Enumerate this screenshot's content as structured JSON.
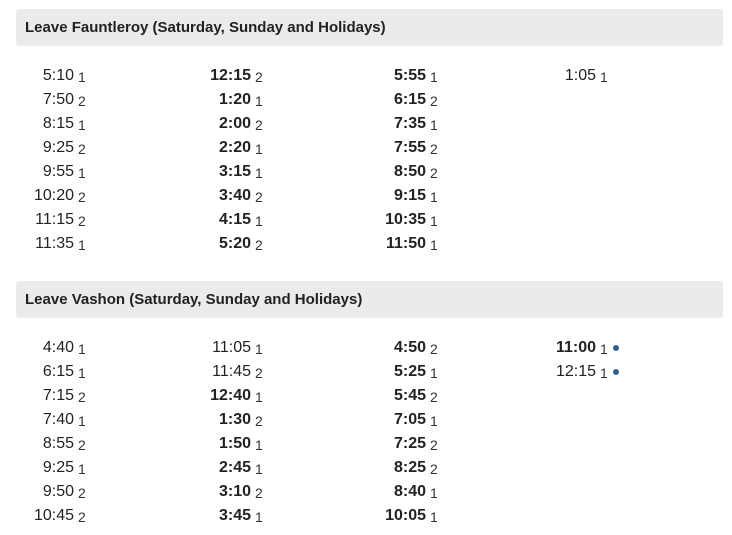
{
  "sections": [
    {
      "title": "Leave Fauntleroy (Saturday, Sunday and Holidays)",
      "columns": [
        [
          {
            "time": "5:10",
            "vessel": "1",
            "bold": false
          },
          {
            "time": "7:50",
            "vessel": "2",
            "bold": false
          },
          {
            "time": "8:15",
            "vessel": "1",
            "bold": false
          },
          {
            "time": "9:25",
            "vessel": "2",
            "bold": false
          },
          {
            "time": "9:55",
            "vessel": "1",
            "bold": false
          },
          {
            "time": "10:20",
            "vessel": "2",
            "bold": false
          },
          {
            "time": "11:15",
            "vessel": "2",
            "bold": false
          },
          {
            "time": "11:35",
            "vessel": "1",
            "bold": false
          }
        ],
        [
          {
            "time": "12:15",
            "vessel": "2",
            "bold": true
          },
          {
            "time": "1:20",
            "vessel": "1",
            "bold": true
          },
          {
            "time": "2:00",
            "vessel": "2",
            "bold": true
          },
          {
            "time": "2:20",
            "vessel": "1",
            "bold": true
          },
          {
            "time": "3:15",
            "vessel": "1",
            "bold": true
          },
          {
            "time": "3:40",
            "vessel": "2",
            "bold": true
          },
          {
            "time": "4:15",
            "vessel": "1",
            "bold": true
          },
          {
            "time": "5:20",
            "vessel": "2",
            "bold": true
          }
        ],
        [
          {
            "time": "5:55",
            "vessel": "1",
            "bold": true
          },
          {
            "time": "6:15",
            "vessel": "2",
            "bold": true
          },
          {
            "time": "7:35",
            "vessel": "1",
            "bold": true
          },
          {
            "time": "7:55",
            "vessel": "2",
            "bold": true
          },
          {
            "time": "8:50",
            "vessel": "2",
            "bold": true
          },
          {
            "time": "9:15",
            "vessel": "1",
            "bold": true
          },
          {
            "time": "10:35",
            "vessel": "1",
            "bold": true
          },
          {
            "time": "11:50",
            "vessel": "1",
            "bold": true
          }
        ],
        [
          {
            "time": "1:05",
            "vessel": "1",
            "bold": false
          }
        ]
      ]
    },
    {
      "title": "Leave Vashon (Saturday, Sunday and Holidays)",
      "columns": [
        [
          {
            "time": "4:40",
            "vessel": "1",
            "bold": false
          },
          {
            "time": "6:15",
            "vessel": "1",
            "bold": false
          },
          {
            "time": "7:15",
            "vessel": "2",
            "bold": false
          },
          {
            "time": "7:40",
            "vessel": "1",
            "bold": false
          },
          {
            "time": "8:55",
            "vessel": "2",
            "bold": false
          },
          {
            "time": "9:25",
            "vessel": "1",
            "bold": false
          },
          {
            "time": "9:50",
            "vessel": "2",
            "bold": false
          },
          {
            "time": "10:45",
            "vessel": "2",
            "bold": false
          }
        ],
        [
          {
            "time": "11:05",
            "vessel": "1",
            "bold": false
          },
          {
            "time": "11:45",
            "vessel": "2",
            "bold": false
          },
          {
            "time": "12:40",
            "vessel": "1",
            "bold": true
          },
          {
            "time": "1:30",
            "vessel": "2",
            "bold": true
          },
          {
            "time": "1:50",
            "vessel": "1",
            "bold": true
          },
          {
            "time": "2:45",
            "vessel": "1",
            "bold": true
          },
          {
            "time": "3:10",
            "vessel": "2",
            "bold": true
          },
          {
            "time": "3:45",
            "vessel": "1",
            "bold": true
          }
        ],
        [
          {
            "time": "4:50",
            "vessel": "2",
            "bold": true
          },
          {
            "time": "5:25",
            "vessel": "1",
            "bold": true
          },
          {
            "time": "5:45",
            "vessel": "2",
            "bold": true
          },
          {
            "time": "7:05",
            "vessel": "1",
            "bold": true
          },
          {
            "time": "7:25",
            "vessel": "2",
            "bold": true
          },
          {
            "time": "8:25",
            "vessel": "2",
            "bold": true
          },
          {
            "time": "8:40",
            "vessel": "1",
            "bold": true
          },
          {
            "time": "10:05",
            "vessel": "1",
            "bold": true
          }
        ],
        [
          {
            "time": "11:00",
            "vessel": "1",
            "bold": true,
            "dot": true
          },
          {
            "time": "12:15",
            "vessel": "1",
            "bold": false,
            "dot": true
          }
        ]
      ]
    }
  ],
  "colors": {
    "header_bg": "#ebebeb",
    "dot": "#2f5f8f"
  }
}
